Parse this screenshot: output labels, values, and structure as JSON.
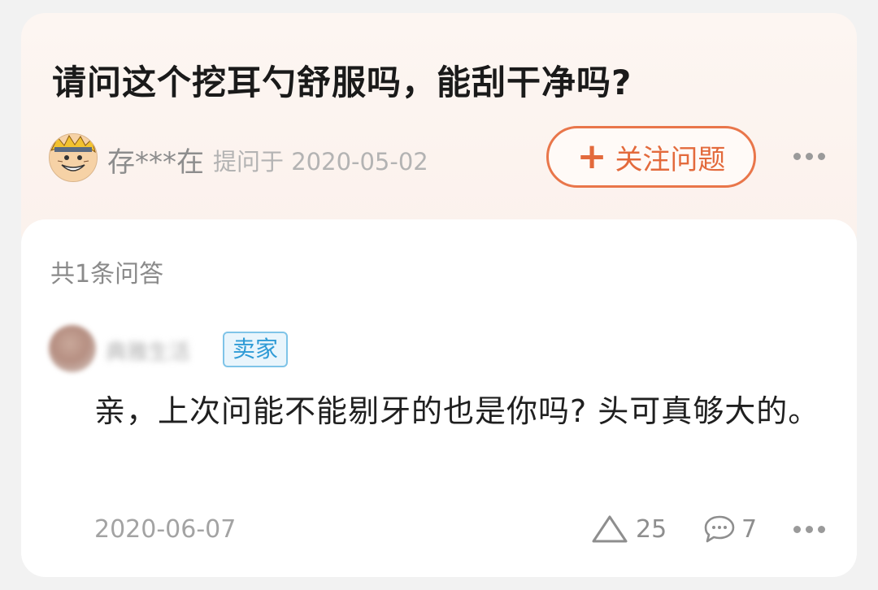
{
  "question": {
    "title": "请问这个挖耳勺舒服吗，能刮干净吗?",
    "asker_name": "存***在",
    "asked_at": "提问于 2020-05-02",
    "follow_label": "关注问题",
    "follow_icon": "plus-icon",
    "more_icon": "more-dots-icon"
  },
  "answers": {
    "count_label": "共1条问答",
    "items": [
      {
        "answerer_name": "典雅生活",
        "badge": "卖家",
        "text": "亲，上次问能不能剔牙的也是你吗? 头可真够大的。",
        "date": "2020-06-07",
        "like_count": "25",
        "comment_count": "7",
        "like_icon": "triangle-up-icon",
        "comment_icon": "chat-bubble-icon",
        "more_icon": "more-dots-icon"
      }
    ]
  },
  "colors": {
    "accent": "#e9764a",
    "badge_blue": "#2f9bd6",
    "question_card_bg": "#fdf6f2"
  }
}
